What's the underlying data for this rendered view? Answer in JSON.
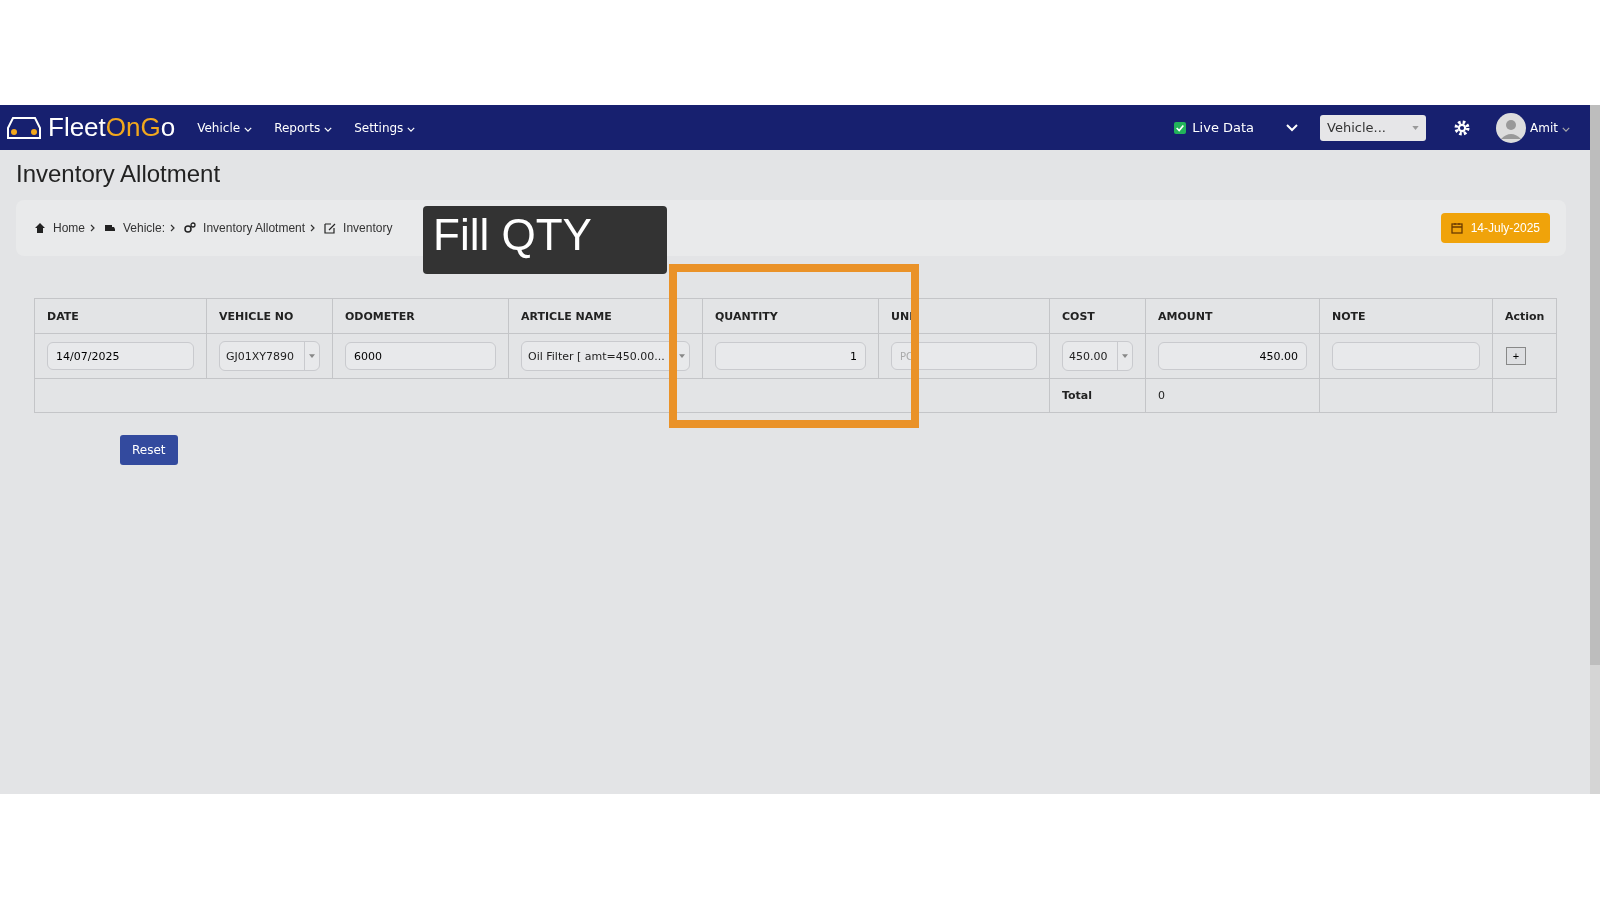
{
  "navbar": {
    "logo": {
      "part_1": "Fleet",
      "part_2": "On",
      "part_3": "G",
      "part_4": "o"
    },
    "menu": [
      {
        "label": "Vehicle"
      },
      {
        "label": "Reports"
      },
      {
        "label": "Settings"
      }
    ],
    "live_data": {
      "label": "Live Data",
      "checked": true
    },
    "vehicle_select": {
      "placeholder": "Vehicle..."
    },
    "user": {
      "name": "Amit"
    }
  },
  "page_title": "Inventory Allotment",
  "breadcrumbs": [
    {
      "label": "Home"
    },
    {
      "label": "Vehicle:"
    },
    {
      "label": "Inventory Allotment"
    },
    {
      "label": "Inventory"
    }
  ],
  "date_badge": "14-July-2025",
  "table": {
    "columns": [
      "DATE",
      "VEHICLE NO",
      "ODOMETER",
      "ARTICLE NAME",
      "QUANTITY",
      "UNI",
      "COST",
      "AMOUNT",
      "NOTE",
      "Action"
    ],
    "row": [
      {
        "kind": "input",
        "value": "14/07/2025"
      },
      {
        "kind": "select",
        "value": "GJ01XY7890"
      },
      {
        "kind": "input",
        "value": "6000"
      },
      {
        "kind": "select",
        "value": "Oil Filter [ amt=450.00..."
      },
      {
        "kind": "number",
        "value": "1"
      },
      {
        "kind": "placeholder",
        "placeholder": "PC"
      },
      {
        "kind": "select",
        "value": "450.00"
      },
      {
        "kind": "number",
        "value": "450.00"
      },
      {
        "kind": "empty"
      },
      {
        "kind": "add",
        "value": "+"
      }
    ],
    "total": {
      "label": "Total",
      "value": "0"
    }
  },
  "reset_button": "Reset",
  "callout": {
    "text": "Fill QTY"
  }
}
